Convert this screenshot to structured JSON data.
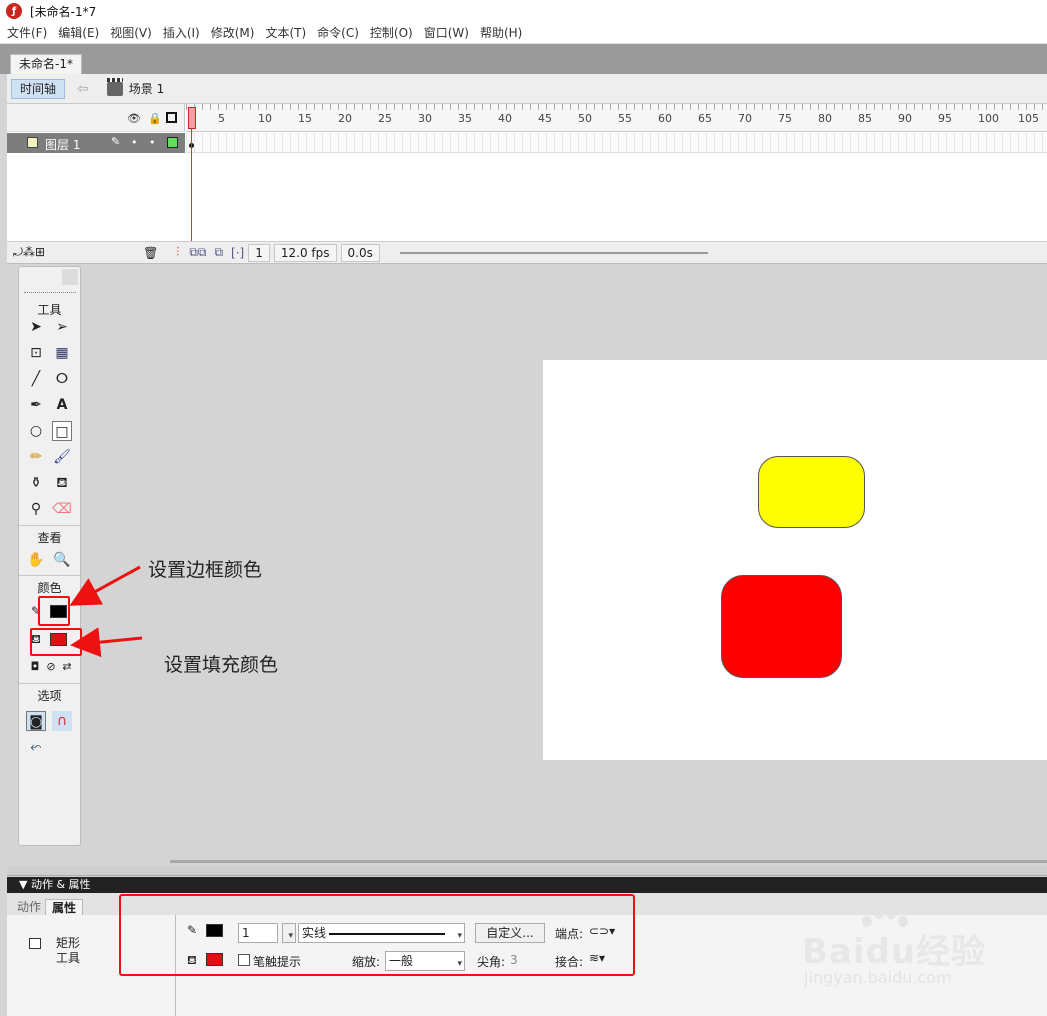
{
  "window": {
    "title": "[未命名-1*7"
  },
  "menu": [
    "文件(F)",
    "编辑(E)",
    "视图(V)",
    "插入(I)",
    "修改(M)",
    "文本(T)",
    "命令(C)",
    "控制(O)",
    "窗口(W)",
    "帮助(H)"
  ],
  "document_tab": "未命名-1*",
  "timeline": {
    "button": "时间轴",
    "scene": "场景 1",
    "layer_name": "图层 1",
    "frame_ticks": [
      "1",
      "5",
      "10",
      "15",
      "20",
      "25",
      "30",
      "35",
      "40",
      "45",
      "50",
      "55",
      "60",
      "65",
      "70",
      "75",
      "80",
      "85",
      "90",
      "95",
      "100",
      "105"
    ],
    "current_frame": "1",
    "fps": "12.0 fps",
    "time": "0.0s"
  },
  "tools": {
    "title": "工具",
    "view_title": "查看",
    "color_title": "颜色",
    "options_title": "选项",
    "stroke_color": "#000000",
    "fill_color": "#dd1111"
  },
  "stage": {
    "yellow_fill": "#ffff00",
    "red_fill": "#ff0000"
  },
  "annotations": {
    "stroke_label": "设置边框颜色",
    "fill_label": "设置填充颜色"
  },
  "properties": {
    "header": "▼ 动作 & 属性",
    "tab_actions": "动作",
    "tab_properties": "属性",
    "tool_name_line1": "矩形",
    "tool_name_line2": "工具",
    "stroke_width": "1",
    "stroke_style": "实线",
    "custom_button": "自定义...",
    "cap_label": "端点:",
    "stroke_hint_label": "笔触提示",
    "scale_label": "缩放:",
    "scale_value": "一般",
    "miter_label": "尖角:",
    "miter_value": "3",
    "join_label": "接合:"
  },
  "watermark": {
    "logo": "Baidu经验",
    "url": "jingyan.baidu.com"
  }
}
